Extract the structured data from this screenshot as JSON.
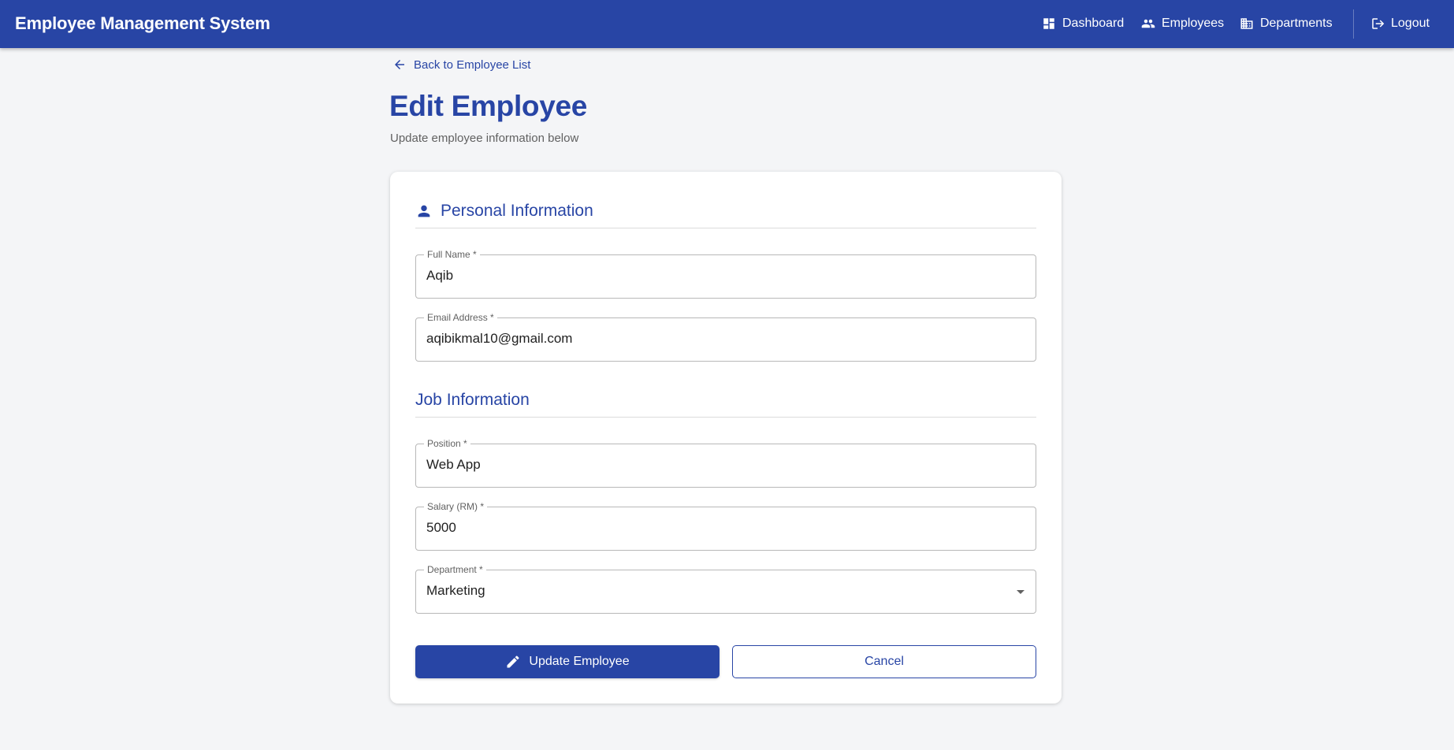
{
  "app": {
    "title": "Employee Management System"
  },
  "nav": {
    "dashboard": "Dashboard",
    "employees": "Employees",
    "departments": "Departments",
    "logout": "Logout"
  },
  "page": {
    "back_label": "Back to Employee List",
    "title": "Edit Employee",
    "subtitle": "Update employee information below"
  },
  "personal": {
    "heading": "Personal Information",
    "full_name": {
      "label": "Full Name *",
      "value": "Aqib"
    },
    "email": {
      "label": "Email Address *",
      "value": "aqibikmal10@gmail.com"
    }
  },
  "job": {
    "heading": "Job Information",
    "position": {
      "label": "Position *",
      "value": "Web App"
    },
    "salary": {
      "label": "Salary (RM) *",
      "value": "5000"
    },
    "department": {
      "label": "Department *",
      "value": "Marketing"
    }
  },
  "actions": {
    "update_label": "Update Employee",
    "cancel_label": "Cancel"
  },
  "colors": {
    "primary": "#2845a5",
    "background": "#f4f5f7"
  }
}
